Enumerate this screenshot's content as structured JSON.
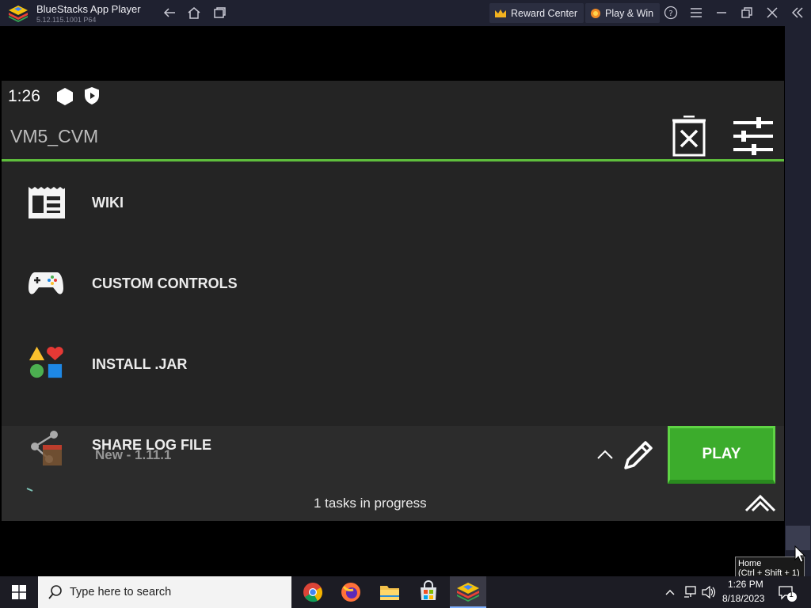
{
  "window": {
    "title": "BlueStacks App Player",
    "version": "5.12.115.1001 P64",
    "reward_center": "Reward Center",
    "play_win": "Play & Win"
  },
  "status_bar": {
    "time": "1:26"
  },
  "launcher": {
    "vm_name": "VM5_CVM",
    "menu": [
      {
        "label": "WIKI",
        "icon": "wiki-icon"
      },
      {
        "label": "CUSTOM CONTROLS",
        "icon": "gamepad-icon"
      },
      {
        "label": "INSTALL .JAR",
        "icon": "shapes-icon"
      },
      {
        "label": "SHARE LOG FILE",
        "icon": "share-icon"
      }
    ],
    "version_selected": "New - 1.11.1",
    "play_label": "PLAY",
    "tasks_text": "1 tasks in progress"
  },
  "tooltip": {
    "title": "Home",
    "shortcut": "(Ctrl + Shift + 1)"
  },
  "taskbar": {
    "search_placeholder": "Type here to search",
    "time": "1:26 PM",
    "date": "8/18/2023",
    "notification_count": "1"
  },
  "colors": {
    "accent_green": "#5fbf3d",
    "play_green": "#3cac2c",
    "titlebar": "#1f2130"
  }
}
